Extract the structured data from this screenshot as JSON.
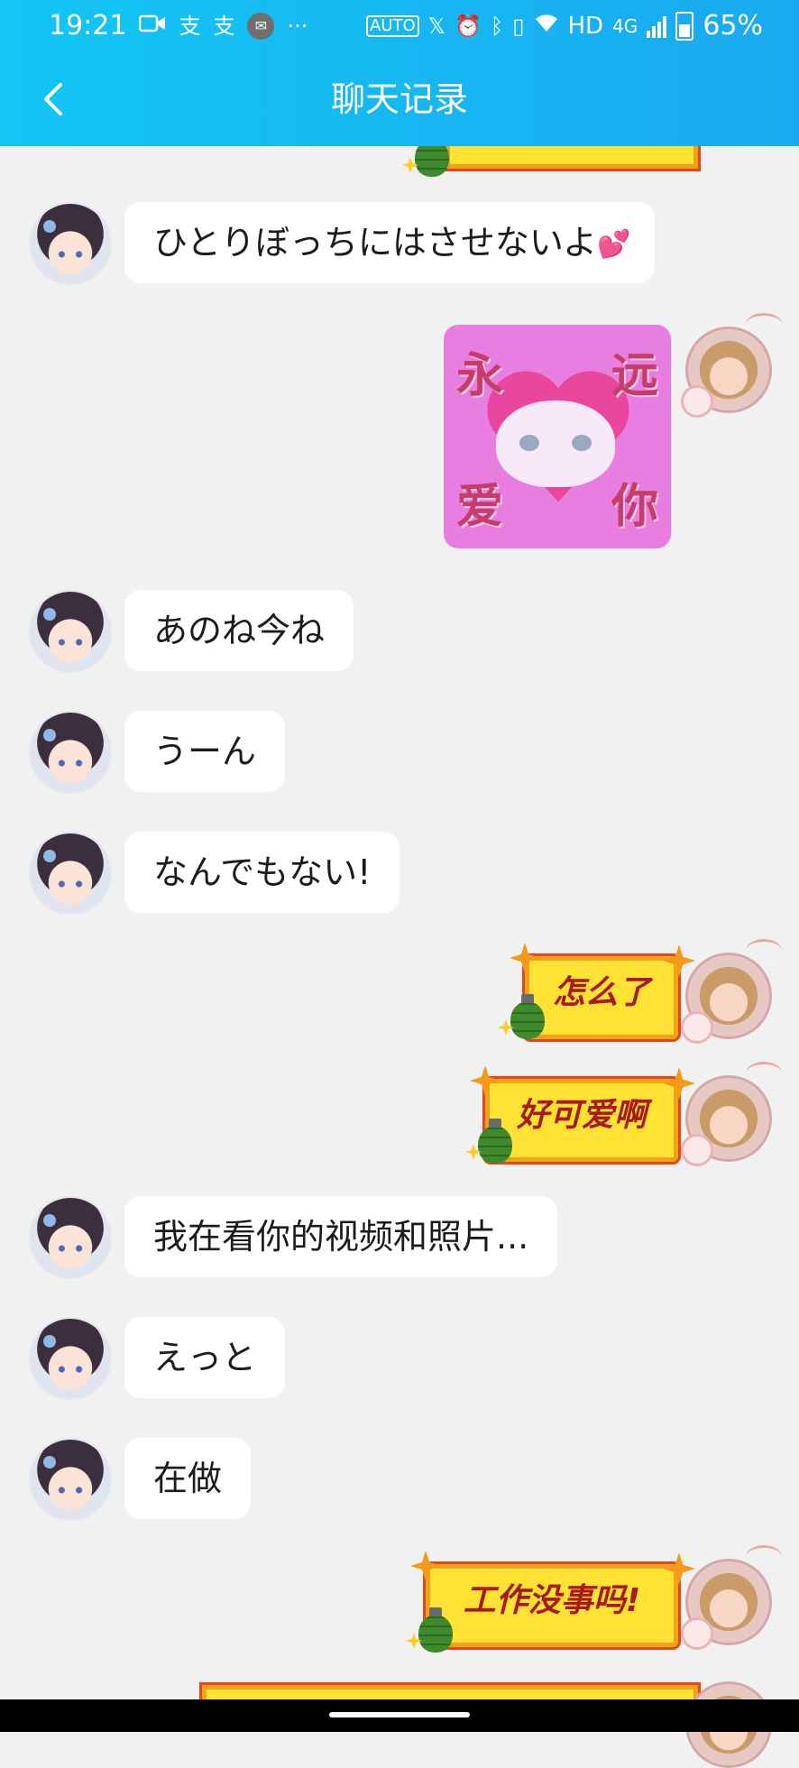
{
  "status_bar": {
    "time": "19:21",
    "left_icons": [
      "video-icon",
      "alipay-icon",
      "alipay-icon",
      "mail-icon",
      "more-icon"
    ],
    "more": "···",
    "auto_label": "AUTO",
    "network": "HD",
    "network_type": "4G",
    "battery": "65%"
  },
  "header": {
    "title": "聊天记录"
  },
  "messages": [
    {
      "side": "left",
      "text": "ひとりぼっちにはさせないよ"
    },
    {
      "side": "right",
      "type": "sticker",
      "chars": [
        "永",
        "远",
        "爱",
        "你"
      ]
    },
    {
      "side": "left",
      "text": "あのね今ね"
    },
    {
      "side": "left",
      "text": "うーん"
    },
    {
      "side": "left",
      "text": "なんでもない!"
    },
    {
      "side": "right",
      "text": "怎么了"
    },
    {
      "side": "right",
      "text": "好可爱啊"
    },
    {
      "side": "left",
      "text": "我在看你的视频和照片..."
    },
    {
      "side": "left",
      "text": "えっと"
    },
    {
      "side": "left",
      "text": "在做"
    },
    {
      "side": "right",
      "text": "工作没事吗!"
    }
  ],
  "colors": {
    "header_start": "#13c6f4",
    "header_end": "#1aa9f0",
    "chat_background": "#f1f1f1",
    "bubble_right_fill": "#ffe233",
    "bubble_right_text": "#a81a16"
  }
}
